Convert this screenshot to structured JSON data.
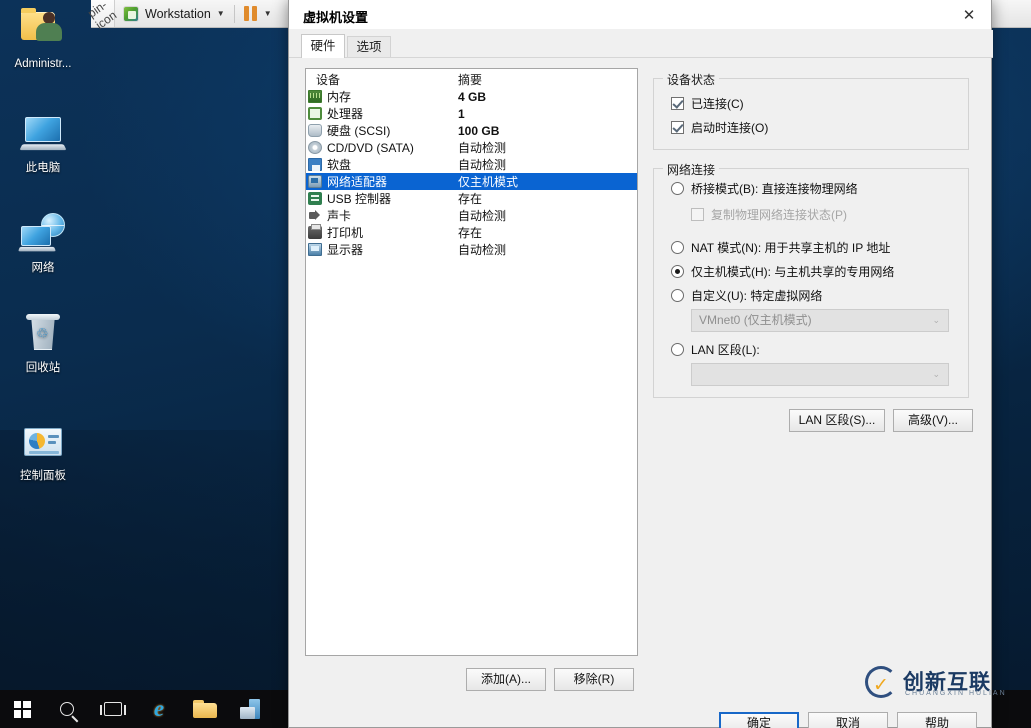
{
  "desktop": {
    "icons": [
      {
        "label": "Administr...",
        "icon": "user-folder-icon"
      },
      {
        "label": "此电脑",
        "icon": "this-pc-icon"
      },
      {
        "label": "网络",
        "icon": "network-icon"
      },
      {
        "label": "回收站",
        "icon": "recycle-bin-icon"
      },
      {
        "label": "控制面板",
        "icon": "control-panel-icon"
      }
    ]
  },
  "taskbar": {
    "items": [
      {
        "name": "start-button",
        "icon": "windows-logo-icon"
      },
      {
        "name": "search-button",
        "icon": "search-icon"
      },
      {
        "name": "task-view-button",
        "icon": "task-view-icon"
      },
      {
        "name": "internet-explorer-button",
        "icon": "internet-explorer-icon"
      },
      {
        "name": "file-explorer-button",
        "icon": "folder-icon"
      },
      {
        "name": "server-manager-button",
        "icon": "server-icon"
      }
    ]
  },
  "vmbar": {
    "pin_icon": "pin-icon",
    "logo_icon": "vmware-logo-icon",
    "title": "Workstation",
    "caret": "▼",
    "pause_icon": "pause-icon",
    "caret2": "▼"
  },
  "dialog": {
    "title": "虚拟机设置",
    "close_icon": "✕",
    "tabs": [
      {
        "label": "硬件",
        "active": true
      },
      {
        "label": "选项",
        "active": false
      }
    ],
    "device_list": {
      "headers": [
        "设备",
        "摘要"
      ],
      "rows": [
        {
          "icon": "memory-icon",
          "name": "内存",
          "summary": "4 GB",
          "selected": false
        },
        {
          "icon": "processor-icon",
          "name": "处理器",
          "summary": "1",
          "selected": false
        },
        {
          "icon": "harddisk-icon",
          "name": "硬盘 (SCSI)",
          "summary": "100 GB",
          "selected": false
        },
        {
          "icon": "cddvd-icon",
          "name": "CD/DVD (SATA)",
          "summary": "自动检测",
          "selected": false
        },
        {
          "icon": "floppy-icon",
          "name": "软盘",
          "summary": "自动检测",
          "selected": false
        },
        {
          "icon": "network-adapter-icon",
          "name": "网络适配器",
          "summary": "仅主机模式",
          "selected": true
        },
        {
          "icon": "usb-icon",
          "name": "USB 控制器",
          "summary": "存在",
          "selected": false
        },
        {
          "icon": "sound-icon",
          "name": "声卡",
          "summary": "自动检测",
          "selected": false
        },
        {
          "icon": "printer-icon",
          "name": "打印机",
          "summary": "存在",
          "selected": false
        },
        {
          "icon": "display-icon",
          "name": "显示器",
          "summary": "自动检测",
          "selected": false
        }
      ]
    },
    "list_buttons": {
      "add": "添加(A)...",
      "remove": "移除(R)"
    },
    "device_status": {
      "caption": "设备状态",
      "connected": {
        "label": "已连接(C)",
        "checked": true
      },
      "connect_at_power_on": {
        "label": "启动时连接(O)",
        "checked": true
      }
    },
    "network_connection": {
      "caption": "网络连接",
      "options": [
        {
          "id": "bridged",
          "label": "桥接模式(B): 直接连接物理网络",
          "selected": false
        },
        {
          "id": "nat",
          "label": "NAT 模式(N): 用于共享主机的 IP 地址",
          "selected": false
        },
        {
          "id": "hostonly",
          "label": "仅主机模式(H): 与主机共享的专用网络",
          "selected": true
        },
        {
          "id": "custom",
          "label": "自定义(U): 特定虚拟网络",
          "selected": false
        },
        {
          "id": "lanseg",
          "label": "LAN 区段(L):",
          "selected": false
        }
      ],
      "replicate_physical": {
        "label": "复制物理网络连接状态(P)",
        "checked": false,
        "disabled": true
      },
      "custom_network_value": "VMnet0 (仅主机模式)",
      "lan_segment_value": "",
      "dropdown_arrow": "⌄"
    },
    "side_buttons": {
      "lan_segments": "LAN 区段(S)...",
      "advanced": "高级(V)..."
    },
    "footer_buttons": {
      "ok": "确定",
      "cancel": "取消",
      "help": "帮助"
    }
  },
  "watermark": {
    "cn": "创新互联",
    "en": "CHUANGXIN HULIAN"
  },
  "colors": {
    "selection_blue": "#0a64d2",
    "desktop_blue": "#0a2d52",
    "accent_orange": "#e08b2c"
  }
}
